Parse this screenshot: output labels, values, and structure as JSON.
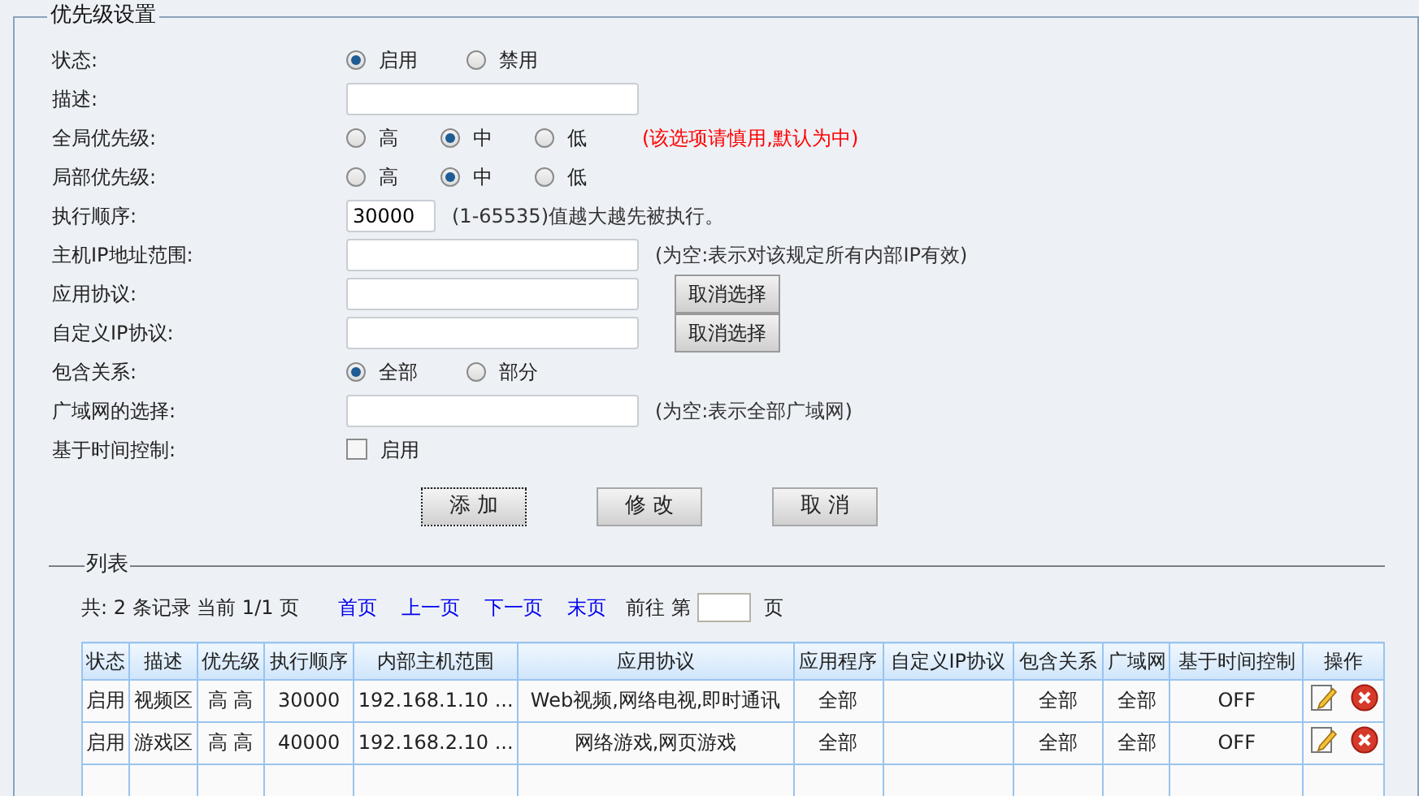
{
  "settings": {
    "title": "优先级设置",
    "rows": [
      {
        "label": "状态:",
        "kind": "radio",
        "options": [
          {
            "label": "启用",
            "selected": true
          },
          {
            "label": "禁用",
            "selected": false
          }
        ]
      },
      {
        "label": "描述:",
        "kind": "text",
        "value": ""
      },
      {
        "label": "全局优先级:",
        "kind": "radio",
        "options": [
          {
            "label": "高",
            "selected": false
          },
          {
            "label": "中",
            "selected": true
          },
          {
            "label": "低",
            "selected": false
          }
        ],
        "note": "(该选项请慎用,默认为中)",
        "warning": true
      },
      {
        "label": "局部优先级:",
        "kind": "radio",
        "options": [
          {
            "label": "高",
            "selected": false
          },
          {
            "label": "中",
            "selected": true
          },
          {
            "label": "低",
            "selected": false
          }
        ]
      },
      {
        "label": "执行顺序:",
        "kind": "short",
        "value": "30000",
        "note": "(1-65535)值越大越先被执行。",
        "warning": false
      },
      {
        "label": "主机IP地址范围:",
        "kind": "text",
        "value": "",
        "note": "(为空:表示对该规定所有内部IP有效)",
        "warning": false
      },
      {
        "label": "应用协议:",
        "kind": "text",
        "value": "",
        "button": "取消选择"
      },
      {
        "label": "自定义IP协议:",
        "kind": "text",
        "value": "",
        "button": "取消选择"
      },
      {
        "label": "包含关系:",
        "kind": "radio",
        "options": [
          {
            "label": "全部",
            "selected": true
          },
          {
            "label": "部分",
            "selected": false
          }
        ]
      },
      {
        "label": "广域网的选择:",
        "kind": "text",
        "value": "",
        "note": "(为空:表示全部广域网)",
        "warning": false
      },
      {
        "label": "基于时间控制:",
        "kind": "checkbox",
        "option": "启用",
        "checked": false
      }
    ],
    "buttons": [
      {
        "label": "添 加",
        "focused": true
      },
      {
        "label": "修 改",
        "focused": false
      },
      {
        "label": "取 消",
        "focused": false
      }
    ]
  },
  "list": {
    "title": "列表",
    "pager": {
      "summary": "共: 2 条记录 当前 1/1 页",
      "links": [
        "首页",
        "上一页",
        "下一页",
        "末页"
      ],
      "goto": "前往 第",
      "suffix": "页"
    },
    "table": {
      "columns": [
        "状态",
        "描述",
        "优先级",
        "执行顺序",
        "内部主机范围",
        "应用协议",
        "应用程序",
        "自定义IP协议",
        "包含关系",
        "广域网",
        "基于时间控制",
        "操作"
      ],
      "rows": [
        [
          "启用",
          "视频区",
          "高 高",
          "30000",
          "192.168.1.10 ...",
          "Web视频,网络电视,即时通讯",
          "全部",
          "",
          "全部",
          "全部",
          "OFF"
        ],
        [
          "启用",
          "游戏区",
          "高 高",
          "40000",
          "192.168.2.10 ...",
          "网络游戏,网页游戏",
          "全部",
          "",
          "全部",
          "全部",
          "OFF"
        ]
      ]
    }
  }
}
